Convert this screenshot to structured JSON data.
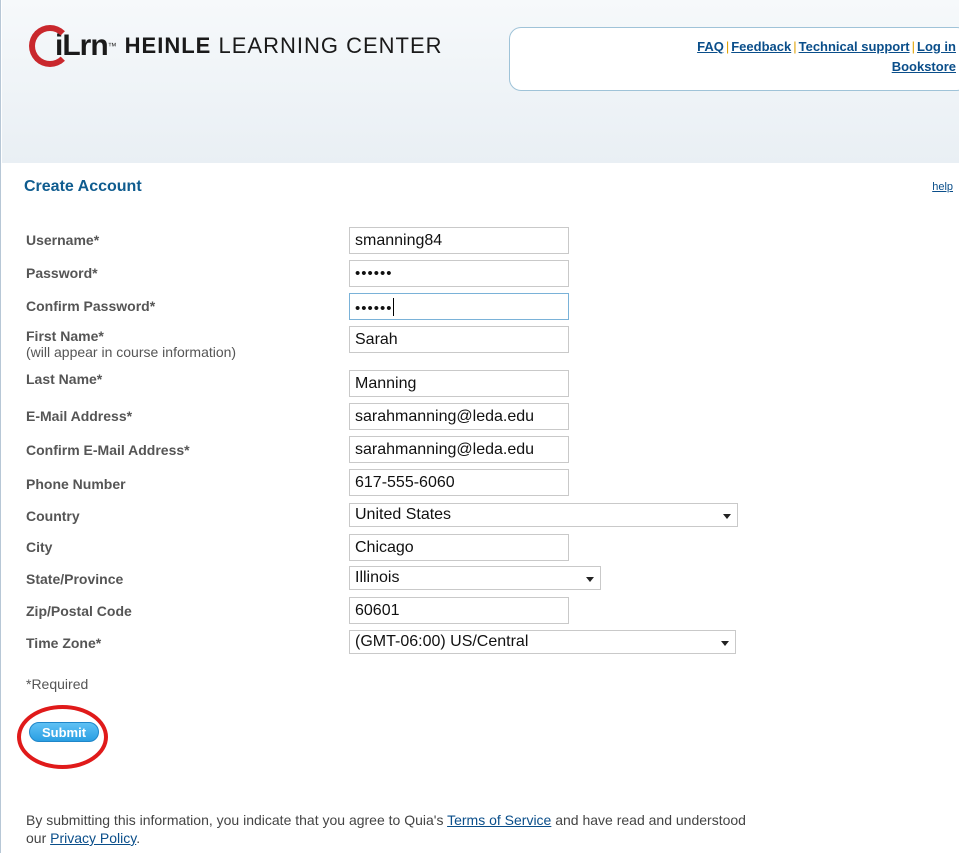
{
  "header": {
    "logo_mark": "iLrn",
    "logo_tm": "™",
    "logo_name_bold": "HEINLE",
    "logo_name_rest": "LEARNING CENTER",
    "nav": {
      "faq": "FAQ",
      "feedback": "Feedback",
      "technical_support": "Technical support",
      "log_in": "Log in",
      "bookstore": "Bookstore",
      "separator": "|"
    }
  },
  "page": {
    "title": "Create Account",
    "help": "help"
  },
  "form": {
    "username": {
      "label": "Username*",
      "value": "smanning84"
    },
    "password": {
      "label": "Password*",
      "value": "••••••"
    },
    "confirm_password": {
      "label": "Confirm Password*",
      "value": "••••••"
    },
    "first_name": {
      "label": "First Name*",
      "sublabel": "(will appear in course information)",
      "value": "Sarah"
    },
    "last_name": {
      "label": "Last Name*",
      "value": "Manning"
    },
    "email": {
      "label": "E-Mail Address*",
      "value": "sarahmanning@leda.edu"
    },
    "confirm_email": {
      "label": "Confirm E-Mail Address*",
      "value": "sarahmanning@leda.edu"
    },
    "phone": {
      "label": "Phone Number",
      "value": "617-555-6060"
    },
    "country": {
      "label": "Country",
      "value": "United States"
    },
    "city": {
      "label": "City",
      "value": "Chicago"
    },
    "state": {
      "label": "State/Province",
      "value": "Illinois"
    },
    "zip": {
      "label": "Zip/Postal Code",
      "value": "60601"
    },
    "timezone": {
      "label": "Time Zone*",
      "value": "(GMT-06:00) US/Central"
    },
    "required_note": "*Required",
    "submit": "Submit"
  },
  "agreement": {
    "text1": "By submitting this information, you indicate that you agree to Quia's ",
    "terms": "Terms of Service",
    "text2": " and have read and understood our ",
    "privacy": "Privacy Policy",
    "text3": "."
  },
  "colors": {
    "accent": "#0f5c8f",
    "link": "#0a4e8a",
    "button": "#2a9fe3",
    "annotation_circle": "#e01a1a"
  }
}
